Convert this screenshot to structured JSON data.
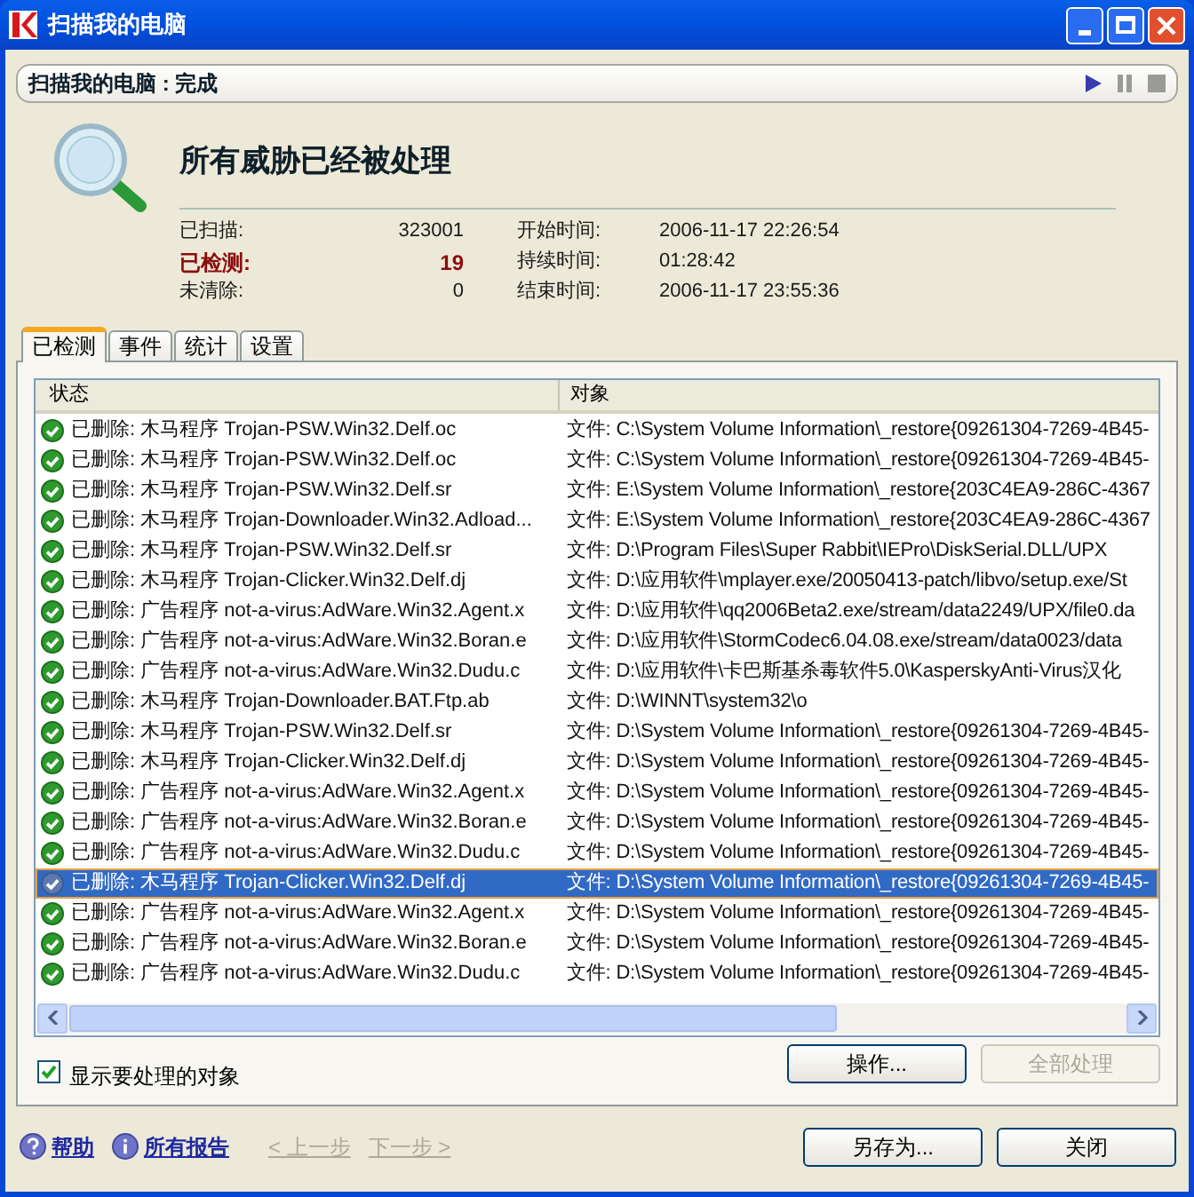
{
  "window": {
    "title": "扫描我的电脑"
  },
  "scan_status": {
    "title": "扫描我的电脑 : 完成",
    "controls": [
      {
        "kind": "play",
        "disabled": false
      },
      {
        "kind": "pause",
        "disabled": true
      },
      {
        "kind": "stop",
        "disabled": true
      }
    ]
  },
  "summary": {
    "heading": "所有威胁已经被处理",
    "stats": [
      {
        "label": "已扫描:",
        "value": "323001",
        "highlight": false
      },
      {
        "label": "已检测:",
        "value": "19",
        "highlight": true
      },
      {
        "label": "未清除:",
        "value": "0",
        "highlight": false
      }
    ],
    "times": [
      {
        "label": "开始时间:",
        "value": "2006-11-17 22:26:54"
      },
      {
        "label": "持续时间:",
        "value": "01:28:42"
      },
      {
        "label": "结束时间:",
        "value": "2006-11-17 23:55:36"
      }
    ]
  },
  "tabs": [
    {
      "label": "已检测",
      "selected": true
    },
    {
      "label": "事件",
      "selected": false
    },
    {
      "label": "统计",
      "selected": false
    },
    {
      "label": "设置",
      "selected": false
    }
  ],
  "table": {
    "columns": [
      "状态",
      "对象"
    ],
    "rows": [
      {
        "status": "已删除: 木马程序 Trojan-PSW.Win32.Delf.oc",
        "object": "文件: C:\\System Volume Information\\_restore{09261304-7269-4B45-",
        "selected": false
      },
      {
        "status": "已删除: 木马程序 Trojan-PSW.Win32.Delf.oc",
        "object": "文件: C:\\System Volume Information\\_restore{09261304-7269-4B45-",
        "selected": false
      },
      {
        "status": "已删除: 木马程序 Trojan-PSW.Win32.Delf.sr",
        "object": "文件: E:\\System Volume Information\\_restore{203C4EA9-286C-4367",
        "selected": false
      },
      {
        "status": "已删除: 木马程序 Trojan-Downloader.Win32.Adload...",
        "object": "文件: E:\\System Volume Information\\_restore{203C4EA9-286C-4367",
        "selected": false
      },
      {
        "status": "已删除: 木马程序 Trojan-PSW.Win32.Delf.sr",
        "object": "文件: D:\\Program Files\\Super Rabbit\\IEPro\\DiskSerial.DLL/UPX",
        "selected": false
      },
      {
        "status": "已删除: 木马程序 Trojan-Clicker.Win32.Delf.dj",
        "object": "文件: D:\\应用软件\\mplayer.exe/20050413-patch/libvo/setup.exe/St",
        "selected": false
      },
      {
        "status": "已删除: 广告程序 not-a-virus:AdWare.Win32.Agent.x",
        "object": "文件: D:\\应用软件\\qq2006Beta2.exe/stream/data2249/UPX/file0.da",
        "selected": false
      },
      {
        "status": "已删除: 广告程序 not-a-virus:AdWare.Win32.Boran.e",
        "object": "文件: D:\\应用软件\\StormCodec6.04.08.exe/stream/data0023/data",
        "selected": false
      },
      {
        "status": "已删除: 广告程序 not-a-virus:AdWare.Win32.Dudu.c",
        "object": "文件: D:\\应用软件\\卡巴斯基杀毒软件5.0\\KasperskyAnti-Virus汉化",
        "selected": false
      },
      {
        "status": "已删除: 木马程序 Trojan-Downloader.BAT.Ftp.ab",
        "object": "文件: D:\\WINNT\\system32\\o",
        "selected": false
      },
      {
        "status": "已删除: 木马程序 Trojan-PSW.Win32.Delf.sr",
        "object": "文件: D:\\System Volume Information\\_restore{09261304-7269-4B45-",
        "selected": false
      },
      {
        "status": "已删除: 木马程序 Trojan-Clicker.Win32.Delf.dj",
        "object": "文件: D:\\System Volume Information\\_restore{09261304-7269-4B45-",
        "selected": false
      },
      {
        "status": "已删除: 广告程序 not-a-virus:AdWare.Win32.Agent.x",
        "object": "文件: D:\\System Volume Information\\_restore{09261304-7269-4B45-",
        "selected": false
      },
      {
        "status": "已删除: 广告程序 not-a-virus:AdWare.Win32.Boran.e",
        "object": "文件: D:\\System Volume Information\\_restore{09261304-7269-4B45-",
        "selected": false
      },
      {
        "status": "已删除: 广告程序 not-a-virus:AdWare.Win32.Dudu.c",
        "object": "文件: D:\\System Volume Information\\_restore{09261304-7269-4B45-",
        "selected": false
      },
      {
        "status": "已删除: 木马程序 Trojan-Clicker.Win32.Delf.dj",
        "object": "文件: D:\\System Volume Information\\_restore{09261304-7269-4B45-",
        "selected": true
      },
      {
        "status": "已删除: 广告程序 not-a-virus:AdWare.Win32.Agent.x",
        "object": "文件: D:\\System Volume Information\\_restore{09261304-7269-4B45-",
        "selected": false
      },
      {
        "status": "已删除: 广告程序 not-a-virus:AdWare.Win32.Boran.e",
        "object": "文件: D:\\System Volume Information\\_restore{09261304-7269-4B45-",
        "selected": false
      },
      {
        "status": "已删除: 广告程序 not-a-virus:AdWare.Win32.Dudu.c",
        "object": "文件: D:\\System Volume Information\\_restore{09261304-7269-4B45-",
        "selected": false
      }
    ]
  },
  "show_objects": {
    "label": "显示要处理的对象",
    "checked": true
  },
  "panel_buttons": [
    {
      "label": "操作...",
      "disabled": false
    },
    {
      "label": "全部处理",
      "disabled": true
    }
  ],
  "footer": {
    "links": [
      {
        "kind": "help",
        "label": "帮助"
      },
      {
        "kind": "info",
        "label": "所有报告"
      }
    ],
    "nav": [
      {
        "label": "< 上一步",
        "disabled": true
      },
      {
        "label": "下一步 >",
        "disabled": true
      }
    ],
    "buttons": [
      {
        "label": "另存为..."
      },
      {
        "label": "关闭"
      }
    ]
  }
}
